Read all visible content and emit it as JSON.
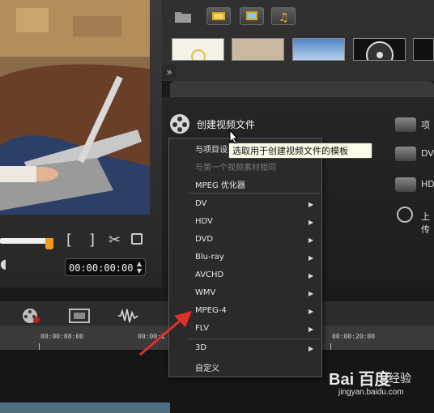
{
  "preview": {
    "timecode": "00:00:00:00",
    "mark_in": "[",
    "mark_out": "]",
    "spin_up": "▲",
    "spin_down": "▼"
  },
  "library": {
    "collapse_glyph": "»"
  },
  "share": {
    "create_video_label": "创建视频文件",
    "side_items": [
      {
        "label": "项",
        "icon": "project-icon"
      },
      {
        "label": "DV",
        "icon": "dv-camera-icon"
      },
      {
        "label": "HDV",
        "icon": "hdv-camera-icon"
      },
      {
        "label": "上传",
        "icon": "globe-icon"
      }
    ]
  },
  "tooltip": "选取用于创建视频文件的模板",
  "menu": {
    "items": [
      {
        "label": "与项目设置相同",
        "dim": false,
        "submenu": false
      },
      {
        "label": "与第一个视频素材相同",
        "dim": true,
        "submenu": false
      },
      {
        "label": "MPEG 优化器",
        "dim": false,
        "submenu": false
      },
      {
        "label": "DV",
        "dim": false,
        "submenu": true
      },
      {
        "label": "HDV",
        "dim": false,
        "submenu": true
      },
      {
        "label": "DVD",
        "dim": false,
        "submenu": true
      },
      {
        "label": "Blu-ray",
        "dim": false,
        "submenu": true
      },
      {
        "label": "AVCHD",
        "dim": false,
        "submenu": true
      },
      {
        "label": "WMV",
        "dim": false,
        "submenu": true
      },
      {
        "label": "MPEG-4",
        "dim": false,
        "submenu": true
      },
      {
        "label": "FLV",
        "dim": false,
        "submenu": true
      },
      {
        "label": "3D",
        "dim": false,
        "submenu": true
      },
      {
        "label": "自定义",
        "dim": false,
        "submenu": false
      }
    ],
    "submenu_glyph": "▶"
  },
  "timeline": {
    "ticks": [
      "00:00:08:00",
      "00:00:1",
      "00:00:20:00"
    ]
  },
  "watermark": {
    "logo": "Bai 百度",
    "jingyan": "经验",
    "url": "jingyan.baidu.com"
  },
  "colors": {
    "accent": "#f39a1f",
    "annotation_arrow": "#e0302a"
  }
}
